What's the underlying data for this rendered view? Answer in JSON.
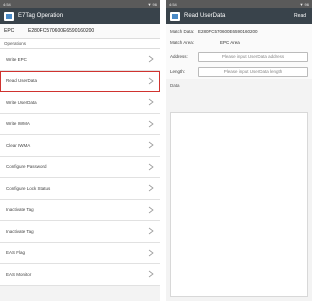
{
  "left": {
    "status": {
      "time": "4:54",
      "right": "▼ 96"
    },
    "app_title": "E7Tag Operation",
    "epc": {
      "label": "EPC",
      "value": "E280FC570600E6590160200"
    },
    "section": "Operations",
    "items": [
      {
        "label": "Write EPC"
      },
      {
        "label": "Read UserData"
      },
      {
        "label": "Write UserData"
      },
      {
        "label": "Write IWMA"
      },
      {
        "label": "Clear IWMA"
      },
      {
        "label": "Configure Password"
      },
      {
        "label": "Configure Lock Status"
      },
      {
        "label": "Inactivate Tag"
      },
      {
        "label": "Inactivate Tag"
      },
      {
        "label": "EAS Flag"
      },
      {
        "label": "EAS Monitor"
      }
    ]
  },
  "right": {
    "status": {
      "time": "4:54",
      "right": "▼ 96"
    },
    "app_title": "Read UserData",
    "action": "Read",
    "match_data": {
      "label": "Match Data:",
      "value": "E280FC570600E6590160200"
    },
    "match_area": {
      "label": "Match Area:",
      "value": "EPC Area"
    },
    "address": {
      "label": "Address:",
      "placeholder": "Please input UserData address"
    },
    "length": {
      "label": "Length:",
      "placeholder": "Please input UserData length"
    },
    "data_label": "Data"
  }
}
